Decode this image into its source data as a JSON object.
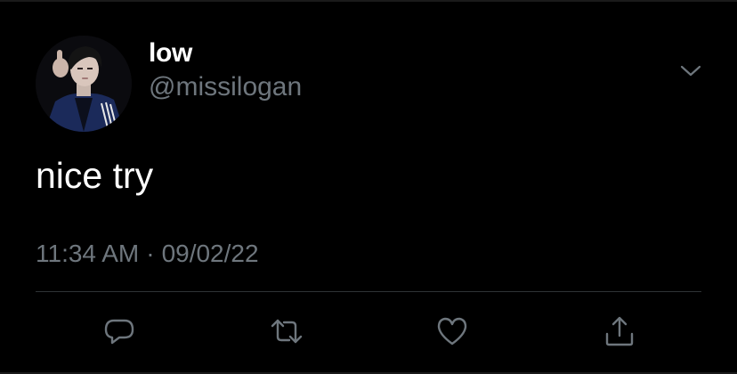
{
  "tweet": {
    "author": {
      "display_name": "low",
      "handle": "@missilogan",
      "avatar_icon": "profile-photo"
    },
    "text": "nice try",
    "time": "11:34 AM",
    "separator": "·",
    "date": "09/02/22"
  },
  "actions": [
    {
      "name": "reply",
      "icon": "speech-bubble-icon"
    },
    {
      "name": "retweet",
      "icon": "retweet-icon"
    },
    {
      "name": "like",
      "icon": "heart-icon"
    },
    {
      "name": "share",
      "icon": "share-icon"
    }
  ],
  "colors": {
    "background": "#000000",
    "primary_text": "#ffffff",
    "secondary_text": "#6e767d",
    "divider": "#2f3336"
  }
}
